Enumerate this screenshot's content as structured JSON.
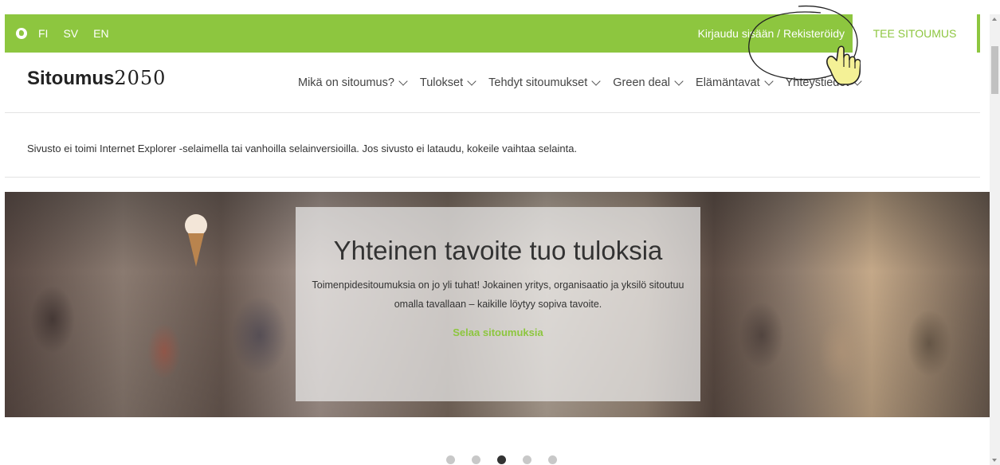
{
  "languages": [
    "FI",
    "SV",
    "EN"
  ],
  "icons": {
    "language": "globe-icon",
    "dropdown": "chevron-down-icon",
    "pointer": "hand-pointer-icon"
  },
  "colors": {
    "brand_green": "#8dc63f",
    "dot_active": "#333333",
    "dot_inactive": "#c8c8c8"
  },
  "topbar": {
    "login": "Kirjaudu sisään",
    "separator": " / ",
    "register": "Rekisteröidy",
    "commit_button": "TEE SITOUMUS"
  },
  "logo": {
    "word": "Sitoumus",
    "number": "2050"
  },
  "nav": [
    "Mikä on sitoumus?",
    "Tulokset",
    "Tehdyt sitoumukset",
    "Green deal",
    "Elämäntavat",
    "Yhteystiedot"
  ],
  "notice": "Sivusto ei toimi Internet Explorer -selaimella tai vanhoilla selainversioilla. Jos sivusto ei lataudu, kokeile vaihtaa selainta.",
  "hero": {
    "title": "Yhteinen tavoite tuo tuloksia",
    "text": "Toimenpidesitoumuksia on jo yli tuhat! Jokainen yritys, organisaatio ja yksilö sitoutuu omalla tavallaan – kaikille löytyy sopiva tavoite.",
    "link": "Selaa sitoumuksia"
  },
  "carousel": {
    "slide_count": 5,
    "active_slide": 3
  }
}
